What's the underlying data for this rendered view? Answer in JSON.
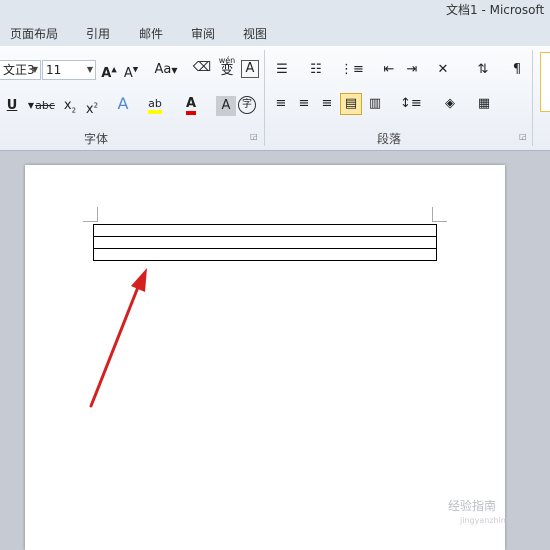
{
  "window": {
    "title": "文档1 - Microsoft"
  },
  "tabs": [
    "页面布局",
    "引用",
    "邮件",
    "审阅",
    "视图"
  ],
  "font_group": {
    "font_name": "文正3",
    "font_size": "11",
    "aa_label": "Aa",
    "wen_label": "wén",
    "group_label": "字体"
  },
  "paragraph_group": {
    "group_label": "段落"
  },
  "document": {
    "table_rows": 3
  },
  "watermark": {
    "text": "经验指南",
    "sub": "jingyanzhinan.com"
  },
  "colors": {
    "arrow": "#d42020",
    "highlight": "#ffff00",
    "font_color": "#e00000"
  }
}
